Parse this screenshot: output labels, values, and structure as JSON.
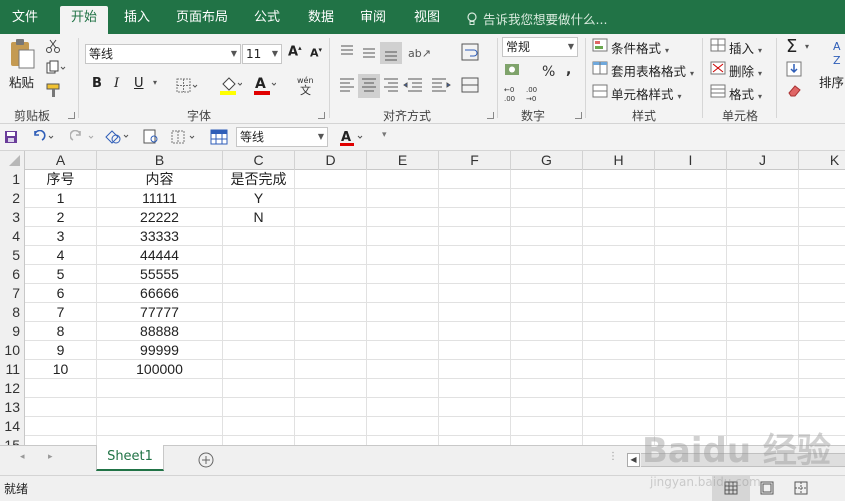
{
  "tabs": [
    "文件",
    "开始",
    "插入",
    "页面布局",
    "公式",
    "数据",
    "审阅",
    "视图"
  ],
  "tell_me": "告诉我您想要做什么...",
  "clipboard": {
    "paste_label": "粘贴",
    "group_label": "剪贴板"
  },
  "font": {
    "name": "等线",
    "size": "11",
    "group_label": "字体"
  },
  "alignment": {
    "group_label": "对齐方式"
  },
  "number": {
    "format": "常规",
    "group_label": "数字"
  },
  "styles": {
    "conditional": "条件格式",
    "table": "套用表格格式",
    "cell": "单元格样式",
    "group_label": "样式"
  },
  "cells": {
    "insert": "插入",
    "delete": "删除",
    "format": "格式",
    "group_label": "单元格"
  },
  "editing": {
    "sort": "排序"
  },
  "qat": {
    "font_name": "等线"
  },
  "colors": {
    "brand": "#217346"
  },
  "columns": [
    "A",
    "B",
    "C",
    "D",
    "E",
    "F",
    "G",
    "H",
    "I",
    "J",
    "K"
  ],
  "rows": [
    {
      "num": "1",
      "a": "序号",
      "b": "内容",
      "c": "是否完成"
    },
    {
      "num": "2",
      "a": "1",
      "b": "11111",
      "c": "Y"
    },
    {
      "num": "3",
      "a": "2",
      "b": "22222",
      "c": "N"
    },
    {
      "num": "4",
      "a": "3",
      "b": "33333",
      "c": ""
    },
    {
      "num": "5",
      "a": "4",
      "b": "44444",
      "c": ""
    },
    {
      "num": "6",
      "a": "5",
      "b": "55555",
      "c": ""
    },
    {
      "num": "7",
      "a": "6",
      "b": "66666",
      "c": ""
    },
    {
      "num": "8",
      "a": "7",
      "b": "77777",
      "c": ""
    },
    {
      "num": "9",
      "a": "8",
      "b": "88888",
      "c": ""
    },
    {
      "num": "10",
      "a": "9",
      "b": "99999",
      "c": ""
    },
    {
      "num": "11",
      "a": "10",
      "b": "100000",
      "c": ""
    },
    {
      "num": "12",
      "a": "",
      "b": "",
      "c": ""
    },
    {
      "num": "13",
      "a": "",
      "b": "",
      "c": ""
    },
    {
      "num": "14",
      "a": "",
      "b": "",
      "c": ""
    },
    {
      "num": "15",
      "a": "",
      "b": "",
      "c": ""
    }
  ],
  "sheet_tab": "Sheet1",
  "status_text": "就绪",
  "watermark": {
    "brand": "Baidu 经验",
    "url": "jingyan.baidu.com"
  }
}
